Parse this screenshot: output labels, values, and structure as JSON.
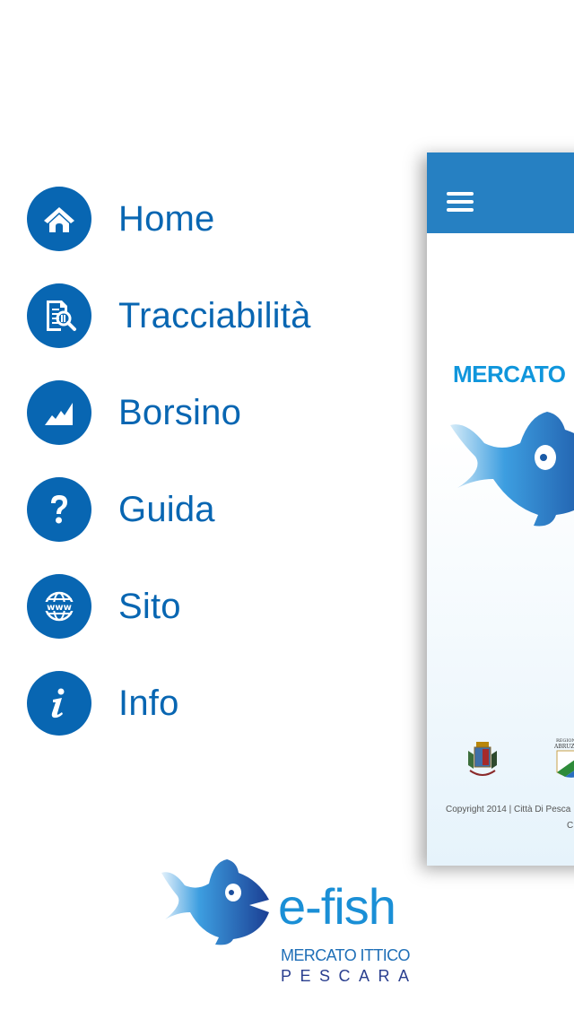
{
  "menu": {
    "items": [
      {
        "label": "Home",
        "icon": "home-icon"
      },
      {
        "label": "Tracciabilità",
        "icon": "document-search-icon"
      },
      {
        "label": "Borsino",
        "icon": "chart-icon"
      },
      {
        "label": "Guida",
        "icon": "question-icon"
      },
      {
        "label": "Sito",
        "icon": "www-globe-icon"
      },
      {
        "label": "Info",
        "icon": "info-icon"
      }
    ]
  },
  "panel": {
    "title": "MERCATO",
    "copyright_line1": "Copyright 2014 | Città Di Pesca",
    "copyright_line2": "C",
    "abruzzo_text": "ABRUZ"
  },
  "logo": {
    "name": "e-fish",
    "subtitle1": "MERCATO ITTICO",
    "subtitle2": "PESCARA"
  },
  "colors": {
    "menu_blue": "#0866b2",
    "header_blue": "#2680c2",
    "title_blue": "#1096dc"
  }
}
